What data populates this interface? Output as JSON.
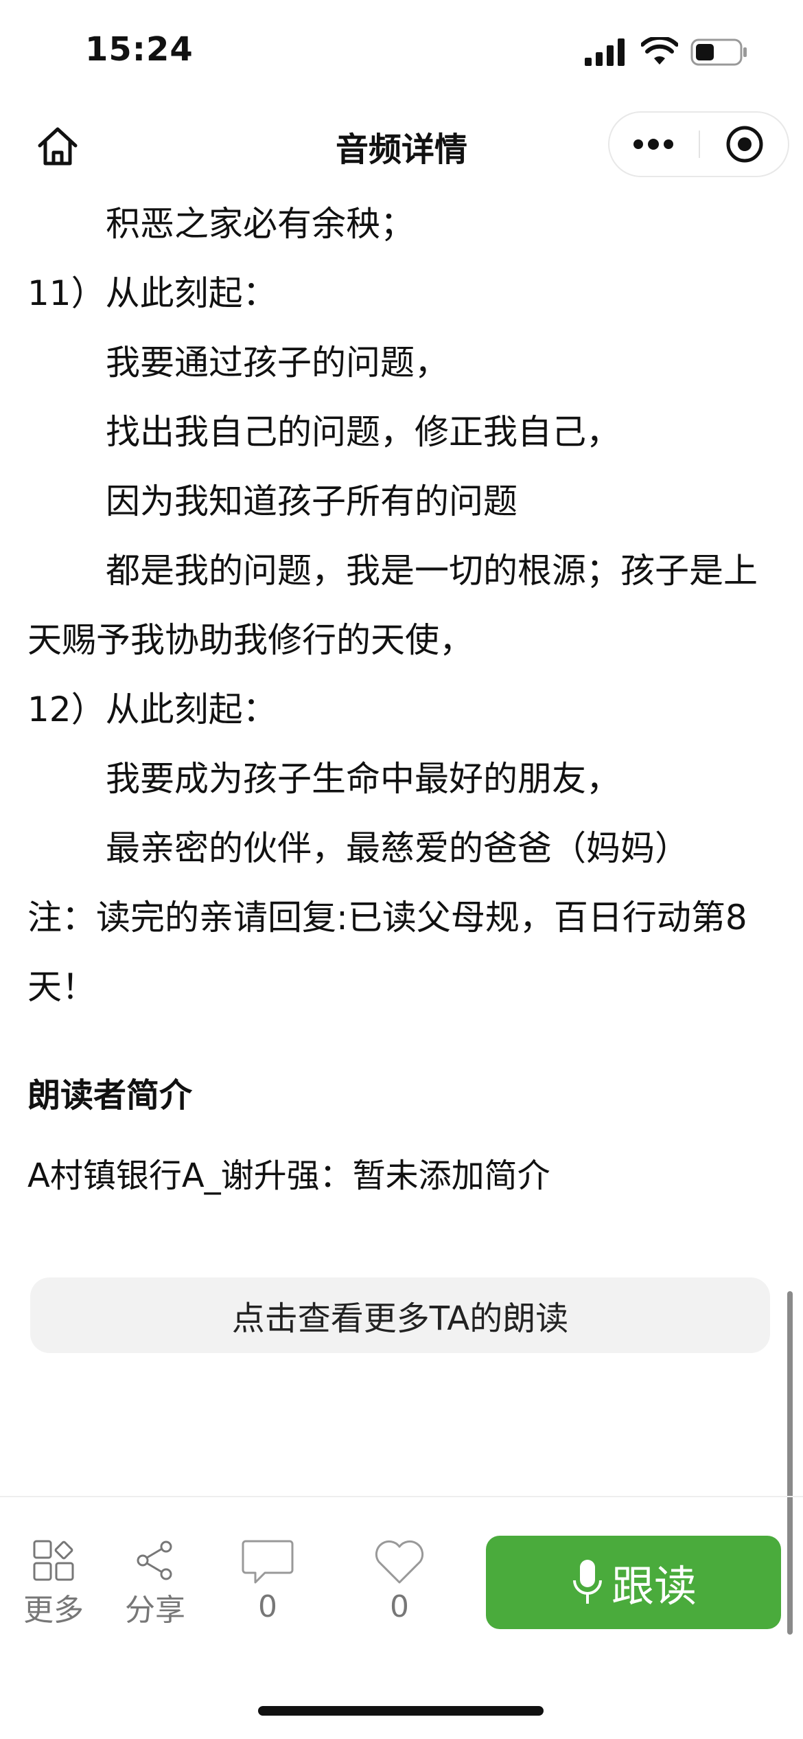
{
  "status_bar": {
    "time": "15:24"
  },
  "nav": {
    "title": "音频详情"
  },
  "content": {
    "lines": [
      "积恶之家必有余秧；",
      "11）从此刻起：",
      "我要通过孩子的问题，",
      "找出我自己的问题，修正我自己，",
      "因为我知道孩子所有的问题",
      "都是我的问题，我是一切的根源；孩子是上天赐予我协助我修行的天使，",
      "12）从此刻起：",
      "我要成为孩子生命中最好的朋友，",
      "最亲密的伙伴，最慈爱的爸爸（妈妈）",
      "注：读完的亲请回复:已读父母规，百日行动第8天！"
    ]
  },
  "reader": {
    "section_title": "朗读者简介",
    "intro": "A村镇银行A_谢升强：暂未添加简介"
  },
  "more_button": "点击查看更多TA的朗读",
  "toolbar": {
    "more_label": "更多",
    "share_label": "分享",
    "comment_count": "0",
    "like_count": "0",
    "follow_label": "跟读"
  },
  "colors": {
    "accent": "#4aab3c"
  }
}
